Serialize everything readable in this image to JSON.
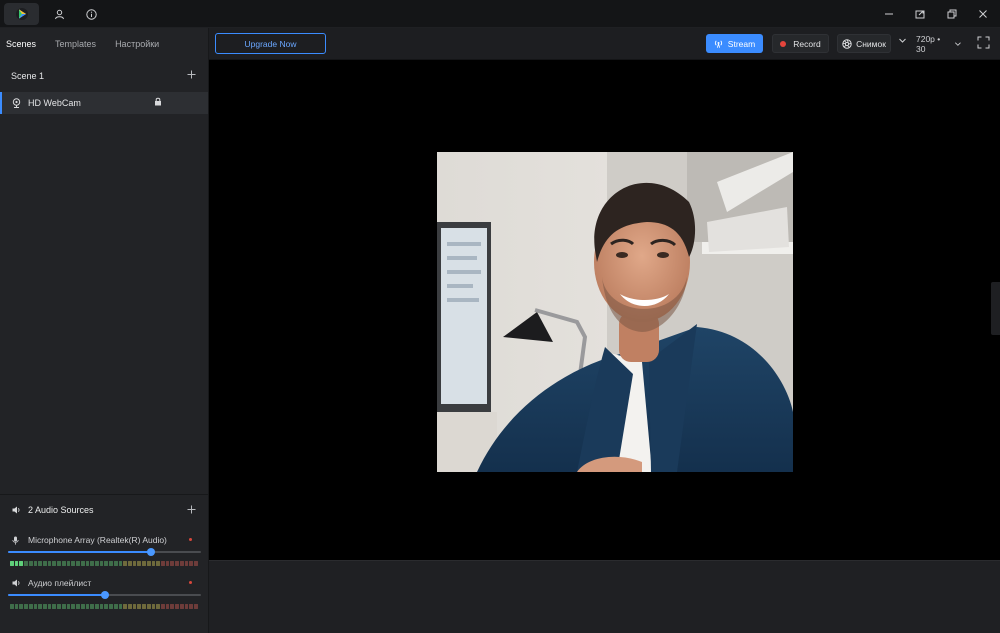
{
  "titlebar": {
    "icons": [
      "app-logo-icon",
      "user-icon",
      "info-icon",
      "minimize-icon",
      "pip-icon",
      "restore-icon",
      "close-icon"
    ]
  },
  "left_panel": {
    "tabs": [
      {
        "label": "Scenes",
        "active": true
      },
      {
        "label": "Templates",
        "active": false
      },
      {
        "label": "Настройки",
        "active": false
      }
    ],
    "scene": {
      "title": "Scene 1"
    },
    "sources": [
      {
        "label": "HD WebCam",
        "locked": true
      }
    ]
  },
  "audio": {
    "header": "2 Audio Sources",
    "tracks": [
      {
        "name": "Microphone Array (Realtek(R) Audio)",
        "volume_percent": 74
      },
      {
        "name": "Аудио плейлист",
        "volume_percent": 50
      }
    ]
  },
  "toolbar": {
    "upgrade_label": "Upgrade Now",
    "stream_label": "Stream",
    "record_label": "Record",
    "snapshot_label": "Снимок",
    "quality_label": "720p • 30"
  },
  "colors": {
    "accent": "#3b8cff",
    "record": "#e5453c",
    "background": "#1b1c1e",
    "panel": "#222326"
  }
}
